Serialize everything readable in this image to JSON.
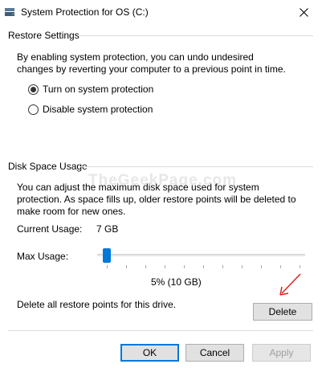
{
  "window": {
    "title": "System Protection for OS (C:)",
    "close_icon": "close-icon",
    "app_icon": "drive-icon"
  },
  "restore_settings": {
    "header": "Restore Settings",
    "description": "By enabling system protection, you can undo undesired changes by reverting your computer to a previous point in time.",
    "options": [
      {
        "label": "Turn on system protection",
        "selected": true
      },
      {
        "label": "Disable system protection",
        "selected": false
      }
    ]
  },
  "disk_space_usage": {
    "header": "Disk Space Usage",
    "description": "You can adjust the maximum disk space used for system protection. As space fills up, older restore points will be deleted to make room for new ones.",
    "current_usage_label": "Current Usage:",
    "current_usage_value": "7 GB",
    "max_usage_label": "Max Usage:",
    "max_usage_value": "5% (10 GB)",
    "max_usage_percent": 5,
    "delete_description": "Delete all restore points for this drive.",
    "delete_label": "Delete"
  },
  "footer": {
    "ok_label": "OK",
    "cancel_label": "Cancel",
    "apply_label": "Apply",
    "apply_enabled": false
  },
  "watermark": "TheGeekPage.com",
  "annotation": {
    "arrow_color": "#e02020"
  },
  "colors": {
    "accent": "#0078d7"
  }
}
